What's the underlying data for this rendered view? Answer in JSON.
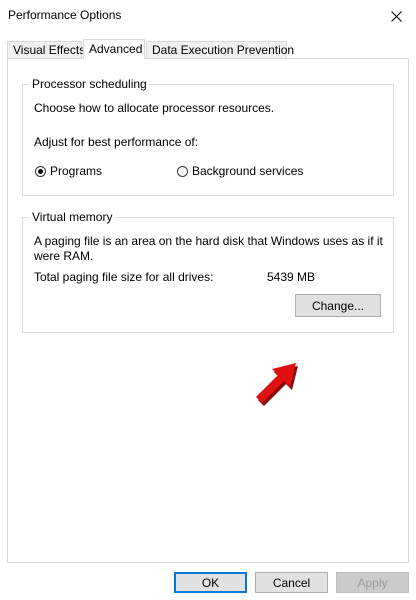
{
  "window": {
    "title": "Performance Options"
  },
  "tabs": [
    {
      "label": "Visual Effects"
    },
    {
      "label": "Advanced"
    },
    {
      "label": "Data Execution Prevention"
    }
  ],
  "processor": {
    "group_title": "Processor scheduling",
    "description": "Choose how to allocate processor resources.",
    "adjust_label": "Adjust for best performance of:",
    "options": [
      {
        "label": "Programs",
        "selected": true
      },
      {
        "label": "Background services",
        "selected": false
      }
    ]
  },
  "virtual_memory": {
    "group_title": "Virtual memory",
    "description_line1": "A paging file is an area on the hard disk that Windows uses as if it",
    "description_line2": "were RAM.",
    "total_label": "Total paging file size for all drives:",
    "total_value": "5439 MB",
    "change_label": "Change..."
  },
  "footer": {
    "ok_label": "OK",
    "cancel_label": "Cancel",
    "apply_label": "Apply"
  },
  "colors": {
    "accent": "#0078d7",
    "arrow": "#e01010"
  }
}
